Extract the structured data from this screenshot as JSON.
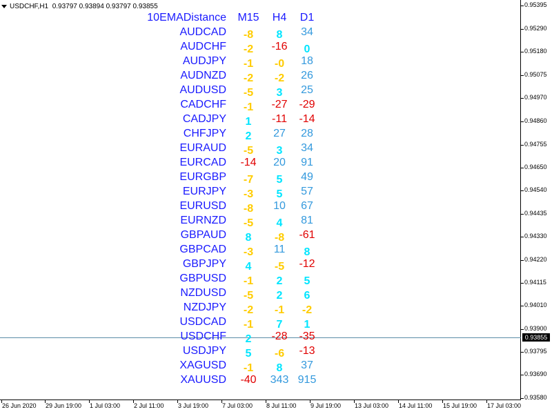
{
  "header": {
    "symbol": "USDCHF,H1",
    "open": "0.93797",
    "high": "0.93894",
    "low": "0.93797",
    "close": "0.93855"
  },
  "table": {
    "title": "10EMADistance",
    "columns": [
      "M15",
      "H4",
      "D1"
    ],
    "rows": [
      {
        "symbol": "AUDCAD",
        "m15": "-8",
        "h4": "8",
        "d1": "34"
      },
      {
        "symbol": "AUDCHF",
        "m15": "-2",
        "h4": "-16",
        "d1": "0"
      },
      {
        "symbol": "AUDJPY",
        "m15": "-1",
        "h4": "-0",
        "d1": "18"
      },
      {
        "symbol": "AUDNZD",
        "m15": "-2",
        "h4": "-2",
        "d1": "26"
      },
      {
        "symbol": "AUDUSD",
        "m15": "-5",
        "h4": "3",
        "d1": "25"
      },
      {
        "symbol": "CADCHF",
        "m15": "-1",
        "h4": "-27",
        "d1": "-29"
      },
      {
        "symbol": "CADJPY",
        "m15": "1",
        "h4": "-11",
        "d1": "-14"
      },
      {
        "symbol": "CHFJPY",
        "m15": "2",
        "h4": "27",
        "d1": "28"
      },
      {
        "symbol": "EURAUD",
        "m15": "-5",
        "h4": "3",
        "d1": "34"
      },
      {
        "symbol": "EURCAD",
        "m15": "-14",
        "h4": "20",
        "d1": "91"
      },
      {
        "symbol": "EURGBP",
        "m15": "-7",
        "h4": "5",
        "d1": "49"
      },
      {
        "symbol": "EURJPY",
        "m15": "-3",
        "h4": "5",
        "d1": "57"
      },
      {
        "symbol": "EURUSD",
        "m15": "-8",
        "h4": "10",
        "d1": "67"
      },
      {
        "symbol": "EURNZD",
        "m15": "-5",
        "h4": "4",
        "d1": "81"
      },
      {
        "symbol": "GBPAUD",
        "m15": "8",
        "h4": "-8",
        "d1": "-61"
      },
      {
        "symbol": "GBPCAD",
        "m15": "-3",
        "h4": "11",
        "d1": "8"
      },
      {
        "symbol": "GBPJPY",
        "m15": "4",
        "h4": "-5",
        "d1": "-12"
      },
      {
        "symbol": "GBPUSD",
        "m15": "-1",
        "h4": "2",
        "d1": "5"
      },
      {
        "symbol": "NZDUSD",
        "m15": "-5",
        "h4": "2",
        "d1": "6"
      },
      {
        "symbol": "NZDJPY",
        "m15": "-2",
        "h4": "-1",
        "d1": "-2"
      },
      {
        "symbol": "USDCAD",
        "m15": "-1",
        "h4": "7",
        "d1": "1"
      },
      {
        "symbol": "USDCHF",
        "m15": "2",
        "h4": "-28",
        "d1": "-35"
      },
      {
        "symbol": "USDJPY",
        "m15": "5",
        "h4": "-6",
        "d1": "-13"
      },
      {
        "symbol": "XAGUSD",
        "m15": "-1",
        "h4": "8",
        "d1": "37"
      },
      {
        "symbol": "XAUUSD",
        "m15": "-40",
        "h4": "343",
        "d1": "915"
      }
    ]
  },
  "price_axis": [
    "0.95395",
    "0.95290",
    "0.95180",
    "0.95075",
    "0.94970",
    "0.94860",
    "0.94755",
    "0.94650",
    "0.94540",
    "0.94435",
    "0.94330",
    "0.94220",
    "0.94115",
    "0.94010",
    "0.93900",
    "0.93855",
    "0.93795",
    "0.93690",
    "0.93580"
  ],
  "time_axis": [
    "26 Jun 2020",
    "29 Jun 19:00",
    "1 Jul 03:00",
    "2 Jul 11:00",
    "3 Jul 19:00",
    "7 Jul 03:00",
    "8 Jul 11:00",
    "9 Jul 19:00",
    "13 Jul 03:00",
    "14 Jul 11:00",
    "15 Jul 19:00",
    "17 Jul 03:00"
  ],
  "current_price": "0.93855",
  "colors": {
    "label": "#1a1aff",
    "small_negative": "#ffcc00",
    "small_positive": "#00e5ff",
    "large_negative": "#e00000",
    "large_positive": "#3399dd",
    "price_line": "#5a8ca6"
  }
}
